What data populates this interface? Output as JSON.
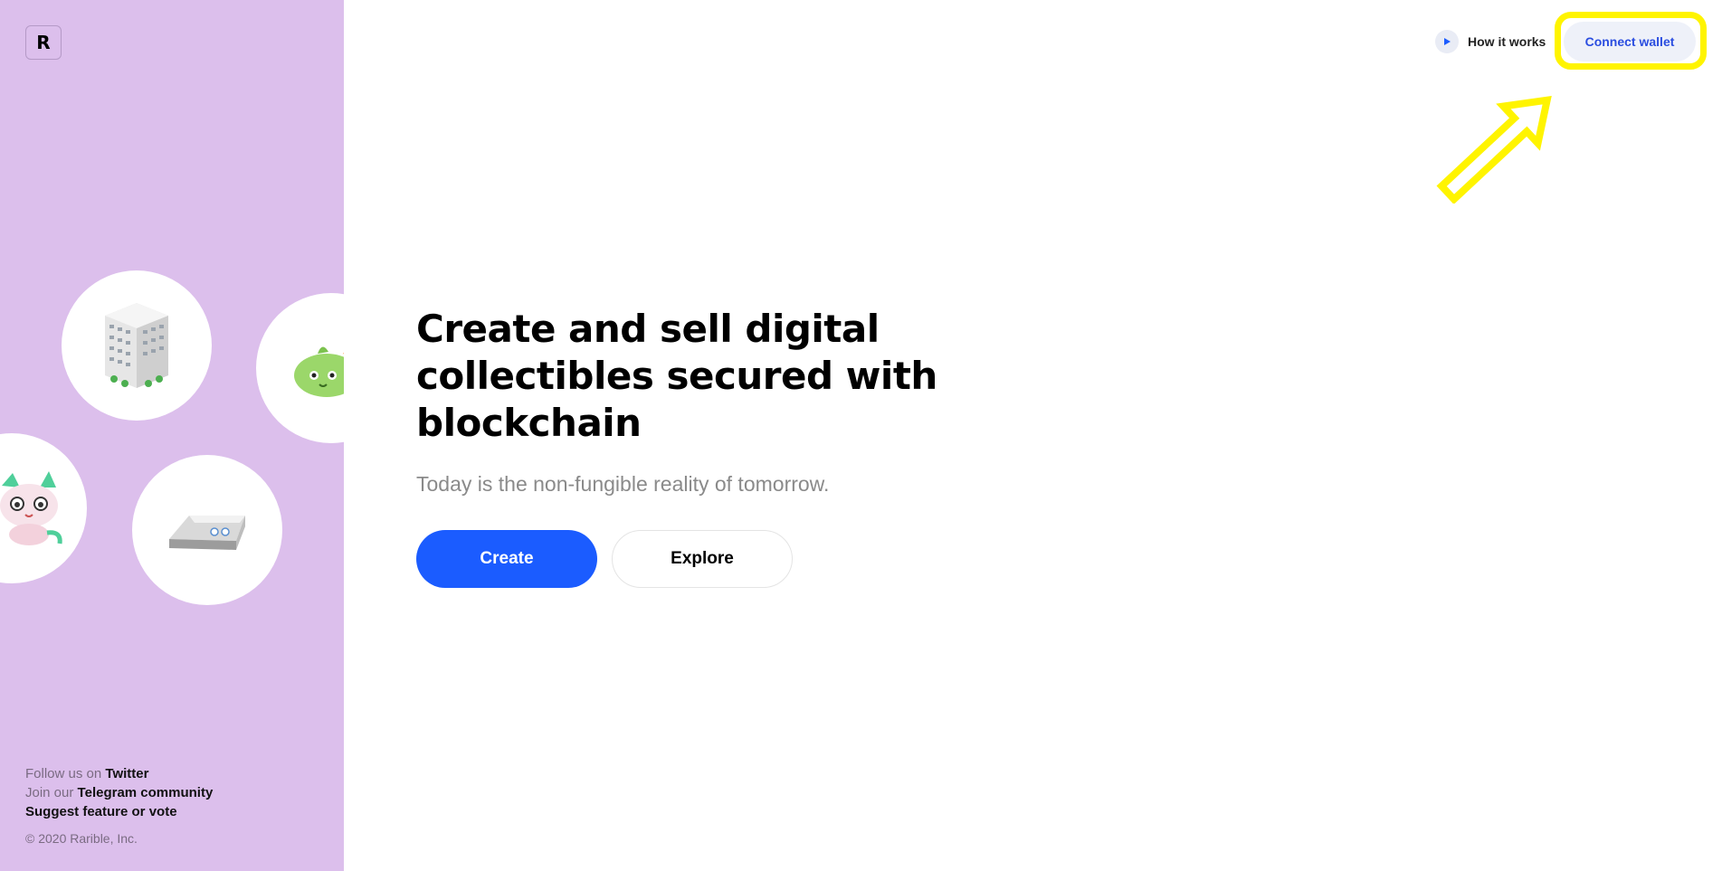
{
  "brand": {
    "logo_letter": "R"
  },
  "nav": {
    "how_it_works_label": "How it works",
    "connect_wallet_label": "Connect wallet"
  },
  "hero": {
    "title": "Create and sell digital collectibles secured with blockchain",
    "subtitle": "Today is the non-fungible reality of tomorrow.",
    "create_label": "Create",
    "explore_label": "Explore"
  },
  "sidebar_footer": {
    "follow_prefix": "Follow us on",
    "twitter_label": "Twitter",
    "join_prefix": "Join our",
    "telegram_label": "Telegram community",
    "suggest_label": "Suggest feature or vote",
    "copyright": "© 2020 Rarible, Inc."
  },
  "colors": {
    "sidebar_bg": "#dcbfec",
    "primary_blue": "#1b5cff",
    "connect_text": "#2a4de0",
    "annotation_yellow": "#fff400"
  },
  "icons": {
    "play": "play-icon",
    "building": "building-icon",
    "creature_green": "axie-creature-icon",
    "creature_cat": "cat-creature-icon",
    "silver_bar": "silver-bar-icon"
  }
}
